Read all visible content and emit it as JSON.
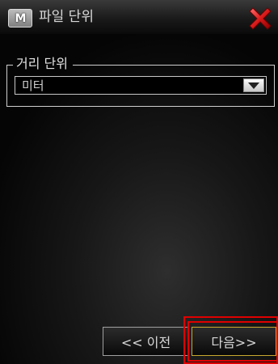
{
  "window": {
    "title": "파일 단위",
    "app_icon_letter": "M",
    "close_icon": "close-x-icon"
  },
  "distance_unit": {
    "group_label": "거리 단위",
    "selected_value": "미터"
  },
  "navigation": {
    "prev_label": "<< 이전",
    "next_label": "다음>>"
  },
  "colors": {
    "close_red": "#d81a1a",
    "highlight_red": "#e00000",
    "next_border": "#c9a830"
  }
}
